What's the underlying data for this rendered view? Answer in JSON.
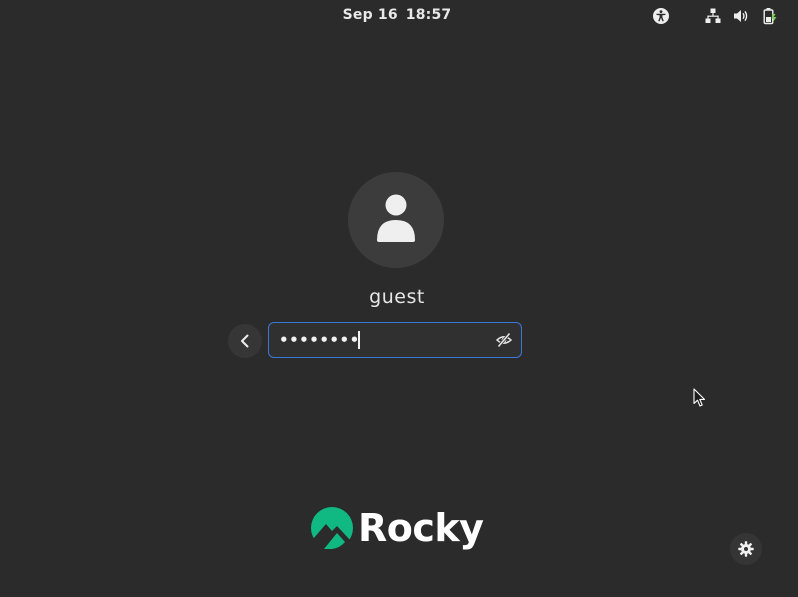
{
  "topbar": {
    "date": "Sep 16",
    "time": "18:57",
    "icons": [
      "accessibility-icon",
      "network-wired-icon",
      "volume-icon",
      "battery-charging-icon"
    ]
  },
  "login": {
    "avatar_icon": "user-icon",
    "username": "guest",
    "password_masked": "••••••••",
    "reveal_icon": "eye-hidden-icon",
    "back_icon": "chevron-left-icon",
    "focus_color": "#3a78d6"
  },
  "branding": {
    "logo_text": "Rocky",
    "logo_color": "#10b981"
  },
  "settings": {
    "icon": "gear-icon"
  }
}
